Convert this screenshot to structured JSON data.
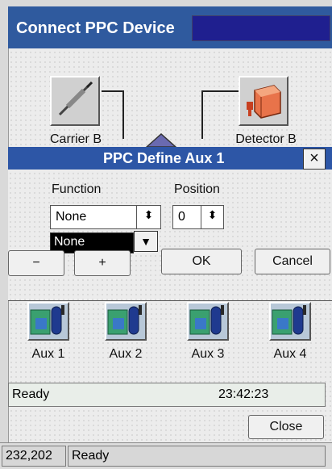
{
  "window": {
    "title": "Connect PPC Device"
  },
  "devices": {
    "carrier_label": "Carrier B",
    "detector_label": "Detector B"
  },
  "dialog": {
    "title": "PPC Define Aux 1",
    "close_glyph": "×",
    "function_label": "Function",
    "position_label": "Position",
    "function_value": "None",
    "position_value": "0",
    "dropdown_option": "None",
    "minus_label": "−",
    "plus_label": "+",
    "ok_label": "OK",
    "cancel_label": "Cancel"
  },
  "aux_items": [
    "Aux 1",
    "Aux 2",
    "Aux 3",
    "Aux 4"
  ],
  "status": {
    "text": "Ready",
    "time": "23:42:23"
  },
  "close_label": "Close",
  "bottom_status": {
    "coords": "232,202",
    "text": "Ready"
  },
  "icons": {
    "carrier": "pipette-icon",
    "detector": "detector-icon",
    "aux": "aux-device-icon",
    "spin": "spin-updown-icon",
    "dropdown": "chevron-down-icon"
  },
  "colors": {
    "titlebar": "#2f5a9e",
    "dialog_title": "#2d56a6",
    "window_bg": "#ececec"
  }
}
